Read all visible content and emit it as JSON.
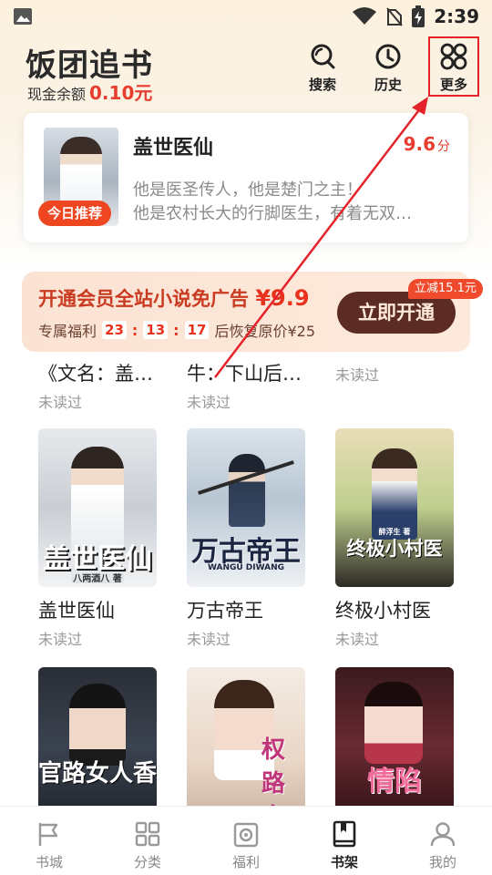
{
  "status_bar": {
    "time": "2:39"
  },
  "header": {
    "app_title": "饭团追书",
    "balance_label": "现金余额",
    "balance_value": "0.10元",
    "search_label": "搜索",
    "history_label": "历史",
    "more_label": "更多"
  },
  "recommend": {
    "badge": "今日推荐",
    "title": "盖世医仙",
    "score": "9.6",
    "score_unit": "分",
    "desc_line1": "他是医圣传人，他是楚门之主！",
    "desc_line2": "他是农村长大的行脚医生，有着无双…"
  },
  "vip": {
    "title": "开通会员全站小说免广告",
    "price": "¥9.9",
    "benefit_label": "专属福利",
    "countdown": {
      "h": "23",
      "m": "13",
      "s": "17"
    },
    "restore_text": "后恢复原价¥25",
    "button": "立即开通",
    "discount_tag": "立减15.1元"
  },
  "partial_row": [
    {
      "title": "《文名：盖…",
      "status": "未读过"
    },
    {
      "title": "牛：下山后…",
      "status": "未读过"
    },
    {
      "title": "未读过",
      "status": ""
    }
  ],
  "books": [
    {
      "title": "盖世医仙",
      "status": "未读过",
      "cover_text": "盖世医仙",
      "cover_sub": "八两酒八 著"
    },
    {
      "title": "万古帝王",
      "status": "未读过",
      "cover_text": "万古帝王",
      "cover_sub": "WANGU DIWANG"
    },
    {
      "title": "终极小村医",
      "status": "未读过",
      "cover_text": "终极小村医",
      "cover_sub": "醉浮生 著"
    },
    {
      "title": "",
      "status": "",
      "cover_text": "官路女人香",
      "cover_sub": ""
    },
    {
      "title": "",
      "status": "",
      "cover_text": "权路多娇",
      "cover_sub": ""
    },
    {
      "title": "",
      "status": "",
      "cover_text": "情陷",
      "cover_sub": ""
    }
  ],
  "bottom_nav": [
    {
      "label": "书城",
      "icon": "flag-icon"
    },
    {
      "label": "分类",
      "icon": "grid-icon"
    },
    {
      "label": "福利",
      "icon": "gift-icon"
    },
    {
      "label": "书架",
      "icon": "bookshelf-icon",
      "active": true
    },
    {
      "label": "我的",
      "icon": "user-icon"
    }
  ],
  "colors": {
    "accent": "#e63d2e",
    "highlight_box": "#e5232a",
    "vip_button": "#5b2b24"
  }
}
